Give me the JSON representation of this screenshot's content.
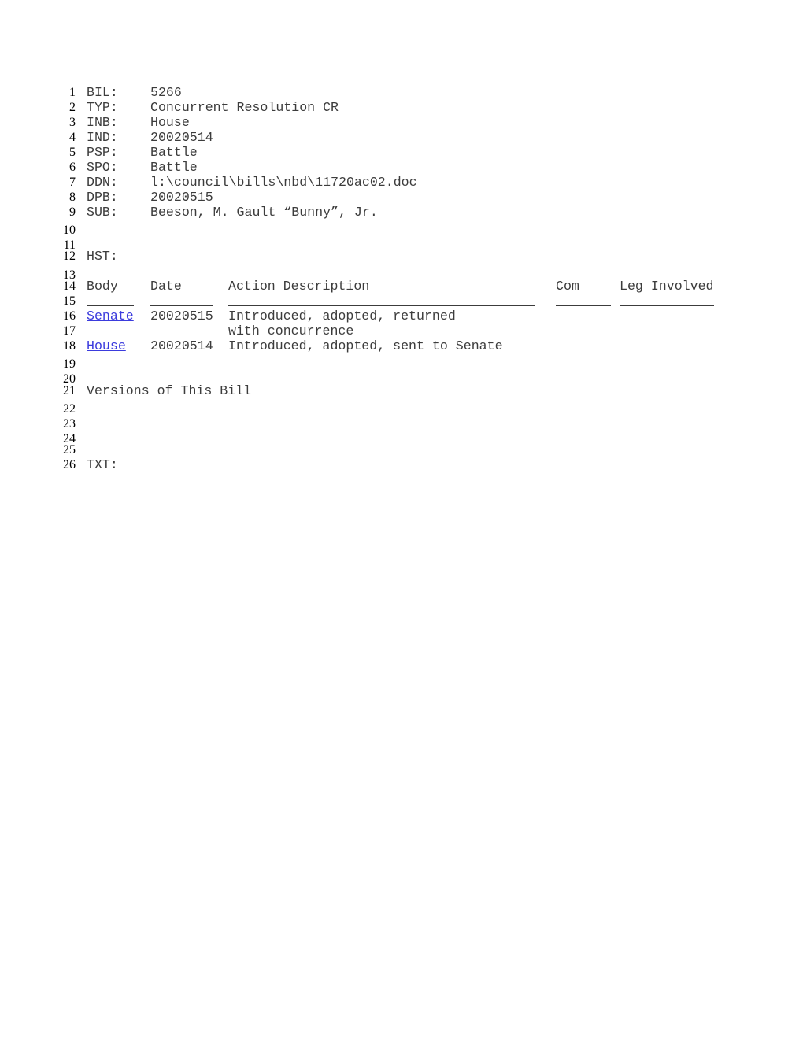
{
  "fields": [
    {
      "line": "1",
      "label": "BIL:",
      "value": "5266"
    },
    {
      "line": "2",
      "label": "TYP:",
      "value": "Concurrent Resolution CR"
    },
    {
      "line": "3",
      "label": "INB:",
      "value": "House"
    },
    {
      "line": "4",
      "label": "IND:",
      "value": "20020514"
    },
    {
      "line": "5",
      "label": "PSP:",
      "value": "Battle"
    },
    {
      "line": "6",
      "label": "SPO:",
      "value": "Battle"
    },
    {
      "line": "7",
      "label": "DDN:",
      "value": "l:\\council\\bills\\nbd\\11720ac02.doc"
    },
    {
      "line": "8",
      "label": "DPB:",
      "value": "20020515"
    },
    {
      "line": "9",
      "label": "SUB:",
      "value": "Beeson, M. Gault “Bunny”, Jr."
    }
  ],
  "line_numbers": {
    "l10": "10",
    "l11": "11",
    "l12": "12",
    "l13": "13",
    "l14": "14",
    "l15": "15",
    "l16": "16",
    "l17": "17",
    "l18": "18",
    "l19": "19",
    "l20": "20",
    "l21": "21",
    "l22": "22",
    "l23": "23",
    "l24": "24",
    "l25": "25",
    "l26": "26"
  },
  "history": {
    "label": "HST:",
    "columns": {
      "body": "Body",
      "date": "Date",
      "description": "Action Description",
      "com": "Com",
      "leg": "Leg Involved"
    },
    "rows": [
      {
        "body": "Senate",
        "date": "20020515",
        "description_line1": "Introduced, adopted, returned",
        "description_line2": "with concurrence",
        "com": "",
        "leg": ""
      },
      {
        "body": "House",
        "date": "20020514",
        "description_line1": "Introduced, adopted, sent to Senate",
        "com": "",
        "leg": ""
      }
    ]
  },
  "versions_heading": "Versions of This Bill",
  "text_label": "TXT:",
  "colors": {
    "link": "#3b3bdd",
    "text": "#3c3c3c"
  }
}
